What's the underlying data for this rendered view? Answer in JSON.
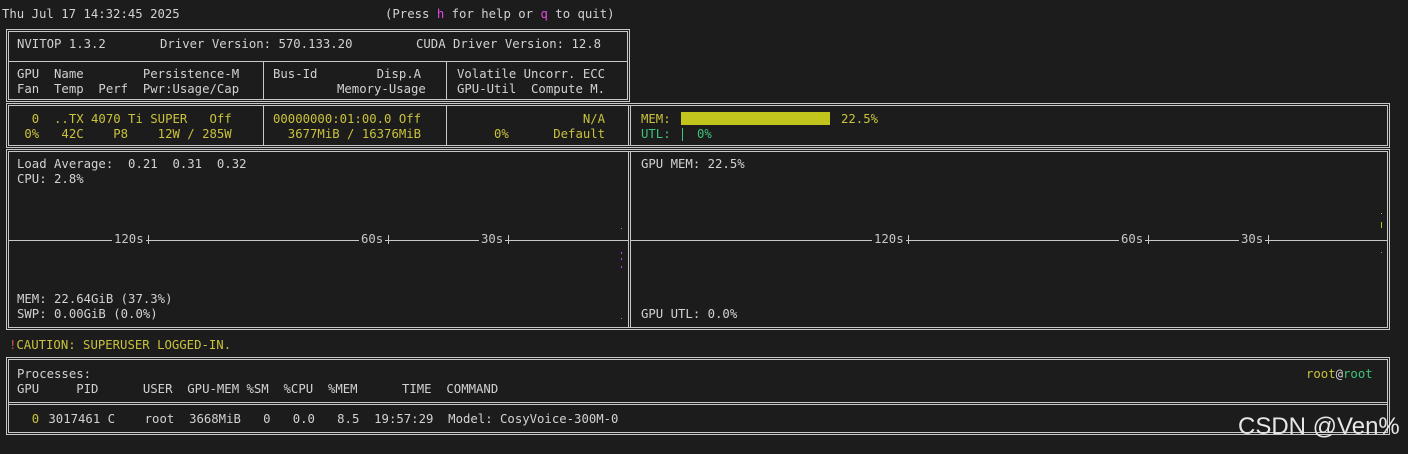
{
  "header": {
    "datetime": "Thu Jul 17 14:32:45 2025",
    "help_prefix": "(Press ",
    "help_key": "h",
    "help_middle": " for help or ",
    "quit_key": "q",
    "help_suffix": " to quit)"
  },
  "info": {
    "app": "NVITOP 1.3.2",
    "driver": "Driver Version: 570.133.20",
    "cuda": "CUDA Driver Version: 12.8"
  },
  "columns": {
    "c1_line1": "GPU  Name        Persistence-M",
    "c1_line2": "Fan  Temp  Perf  Pwr:Usage/Cap",
    "c2_line1": "Bus-Id        Disp.A",
    "c2_line2": "Memory-Usage",
    "c3_line1": "Volatile Uncorr. ECC",
    "c3_line2": "GPU-Util  Compute M."
  },
  "gpu": {
    "line1_c1": "  0  ..TX 4070 Ti SUPER   Off",
    "line2_c1": " 0%   42C    P8    12W / 285W",
    "line1_c2": "00000000:01:00.0 Off",
    "line2_c2": "  3677MiB / 16376MiB",
    "line1_c3": "                 N/A",
    "line2_c3": "     0%      Default",
    "mem_label": "MEM:",
    "mem_value": "22.5%",
    "mem_fraction": 0.225,
    "utl_label": "UTL:",
    "utl_value": "0%"
  },
  "host": {
    "load": "Load Average:  0.21  0.31  0.32",
    "cpu": "CPU: 2.8%",
    "mem": "MEM: 22.64GiB (37.3%)",
    "swp": "SWP: 0.00GiB (0.0%)",
    "gpu_mem": "GPU MEM: 22.5%",
    "gpu_utl": "GPU UTL: 0.0%"
  },
  "axis_labels": [
    "120s",
    "60s",
    "30s"
  ],
  "caution": {
    "mark": "!",
    "text": "CAUTION: SUPERUSER LOGGED-IN."
  },
  "processes": {
    "title": "Processes:",
    "user": "root",
    "at": "@",
    "host": "root",
    "headers": "GPU     PID      USER  GPU-MEM %SM  %CPU  %MEM      TIME  COMMAND",
    "row_gpu": "  0",
    "row_rest": " 3017461 C    root  3668MiB   0   0.0   8.5  19:57:29  Model: CosyVoice-300M-0"
  },
  "watermark": "CSDN @Ven%"
}
